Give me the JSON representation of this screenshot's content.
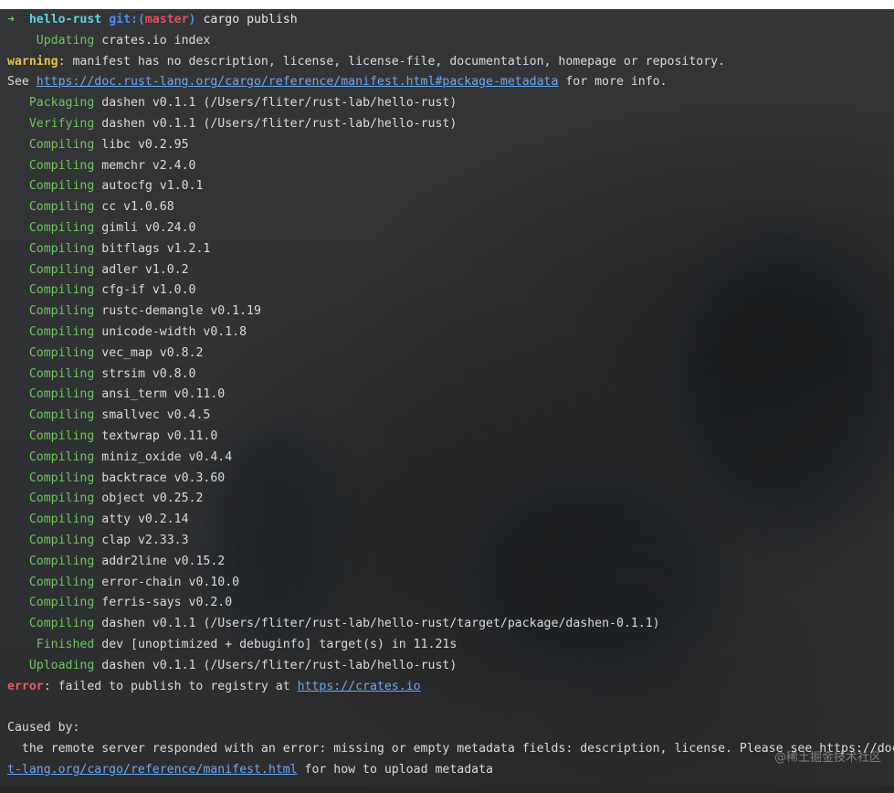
{
  "prompt": {
    "arrow": "➜",
    "dir": "hello-rust",
    "git_label": "git:(",
    "branch": "master",
    "git_close": ")",
    "command": "cargo publish"
  },
  "lines": [
    {
      "status": "Updating",
      "text": "crates.io index"
    },
    {
      "warning_label": "warning",
      "text": ": manifest has no description, license, license-file, documentation, homepage or repository."
    },
    {
      "prefix": "See ",
      "link": "https://doc.rust-lang.org/cargo/reference/manifest.html#package-metadata",
      "suffix": " for more info."
    },
    {
      "status": "Packaging",
      "text": "dashen v0.1.1 (/Users/fliter/rust-lab/hello-rust)"
    },
    {
      "status": "Verifying",
      "text": "dashen v0.1.1 (/Users/fliter/rust-lab/hello-rust)"
    },
    {
      "status": "Compiling",
      "text": "libc v0.2.95"
    },
    {
      "status": "Compiling",
      "text": "memchr v2.4.0"
    },
    {
      "status": "Compiling",
      "text": "autocfg v1.0.1"
    },
    {
      "status": "Compiling",
      "text": "cc v1.0.68"
    },
    {
      "status": "Compiling",
      "text": "gimli v0.24.0"
    },
    {
      "status": "Compiling",
      "text": "bitflags v1.2.1"
    },
    {
      "status": "Compiling",
      "text": "adler v1.0.2"
    },
    {
      "status": "Compiling",
      "text": "cfg-if v1.0.0"
    },
    {
      "status": "Compiling",
      "text": "rustc-demangle v0.1.19"
    },
    {
      "status": "Compiling",
      "text": "unicode-width v0.1.8"
    },
    {
      "status": "Compiling",
      "text": "vec_map v0.8.2"
    },
    {
      "status": "Compiling",
      "text": "strsim v0.8.0"
    },
    {
      "status": "Compiling",
      "text": "ansi_term v0.11.0"
    },
    {
      "status": "Compiling",
      "text": "smallvec v0.4.5"
    },
    {
      "status": "Compiling",
      "text": "textwrap v0.11.0"
    },
    {
      "status": "Compiling",
      "text": "miniz_oxide v0.4.4"
    },
    {
      "status": "Compiling",
      "text": "backtrace v0.3.60"
    },
    {
      "status": "Compiling",
      "text": "object v0.25.2"
    },
    {
      "status": "Compiling",
      "text": "atty v0.2.14"
    },
    {
      "status": "Compiling",
      "text": "clap v2.33.3"
    },
    {
      "status": "Compiling",
      "text": "addr2line v0.15.2"
    },
    {
      "status": "Compiling",
      "text": "error-chain v0.10.0"
    },
    {
      "status": "Compiling",
      "text": "ferris-says v0.2.0"
    },
    {
      "status": "Compiling",
      "text": "dashen v0.1.1 (/Users/fliter/rust-lab/hello-rust/target/package/dashen-0.1.1)"
    },
    {
      "status": "Finished",
      "text": "dev [unoptimized + debuginfo] target(s) in 11.21s"
    },
    {
      "status": "Uploading",
      "text": "dashen v0.1.1 (/Users/fliter/rust-lab/hello-rust)"
    },
    {
      "error_label": "error",
      "text": ": failed to publish to registry at ",
      "link": "https://crates.io"
    },
    {
      "text": ""
    },
    {
      "text": "Caused by:"
    },
    {
      "text": "  the remote server responded with an error: missing or empty metadata fields: description, license. Please see https://doc.rus"
    },
    {
      "link": "t-lang.org/cargo/reference/manifest.html",
      "suffix": " for how to upload metadata"
    }
  ],
  "watermark": "@稀土掘金技术社区",
  "colors": {
    "background": "#2f3133",
    "status_green": "#6ec85a",
    "warning_yellow": "#e7c04e",
    "error_red": "#ef5a5a",
    "link_blue": "#6da8f0"
  }
}
